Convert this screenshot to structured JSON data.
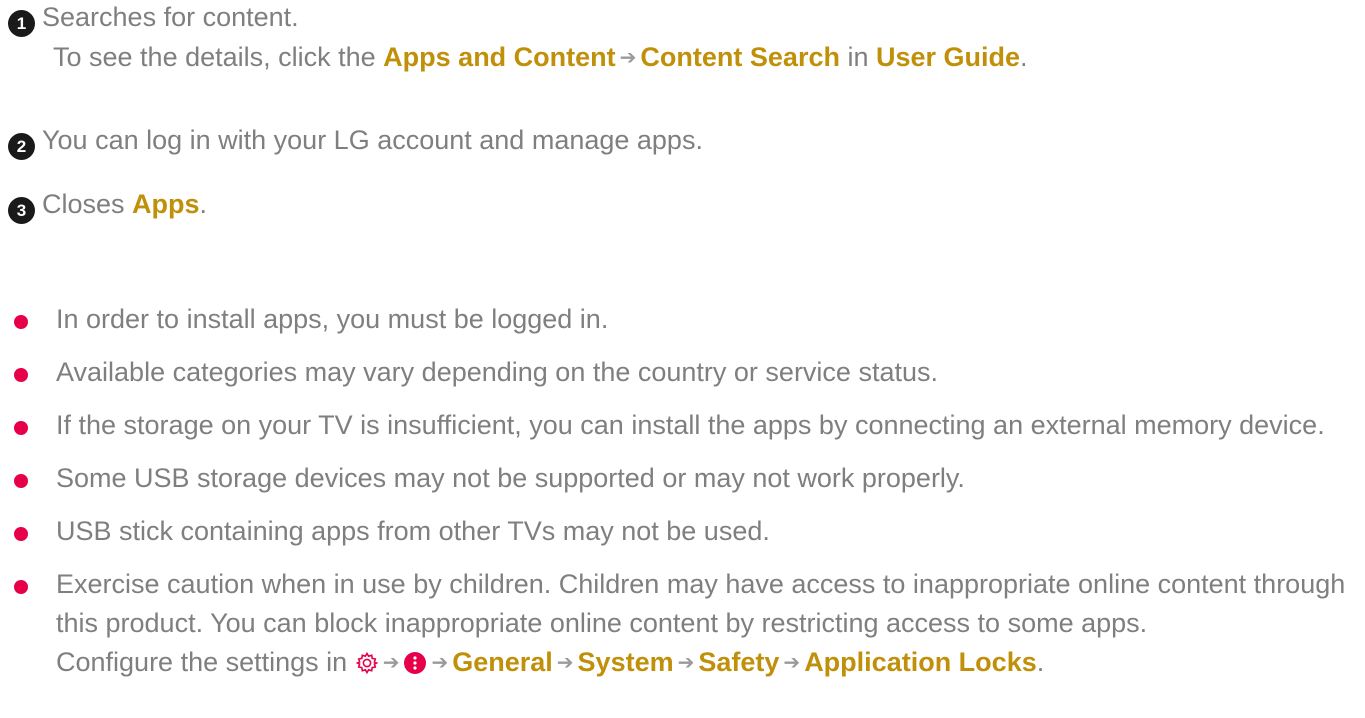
{
  "callouts": [
    {
      "number": "1",
      "text": "Searches for content.",
      "sub": {
        "prefix": "To see the details, click the ",
        "link1": "Apps and Content",
        "link2": "Content Search",
        "middle": " in ",
        "link3": "User Guide",
        "suffix": "."
      }
    },
    {
      "number": "2",
      "text": "You can log in with your LG account and manage apps."
    },
    {
      "number": "3",
      "prefix": "Closes ",
      "link": "Apps",
      "suffix": "."
    }
  ],
  "arrow": "➔",
  "bullets": [
    "In order to install apps, you must be logged in.",
    "Available categories may vary depending on the country or service status.",
    "If the storage on your TV is insufficient, you can install the apps by connecting an external memory device.",
    "Some USB storage devices may not be supported or may not work properly.",
    "USB stick containing apps from other TVs may not be used.",
    "Exercise caution when in use by children. Children may have access to inappropriate online content through this product. You can block inappropriate online content by restricting access to some apps."
  ],
  "settings_path": {
    "prefix": "Configure the settings in ",
    "icons": [
      "gear-icon",
      "more-options-icon"
    ],
    "steps": [
      "General",
      "System",
      "Safety",
      "Application Locks"
    ],
    "suffix": "."
  },
  "colors": {
    "text": "#7f7f7f",
    "highlight": "#c0900a",
    "bullet": "#e6004a",
    "number_badge": "#1a1a1a",
    "icon": "#e6004a"
  }
}
